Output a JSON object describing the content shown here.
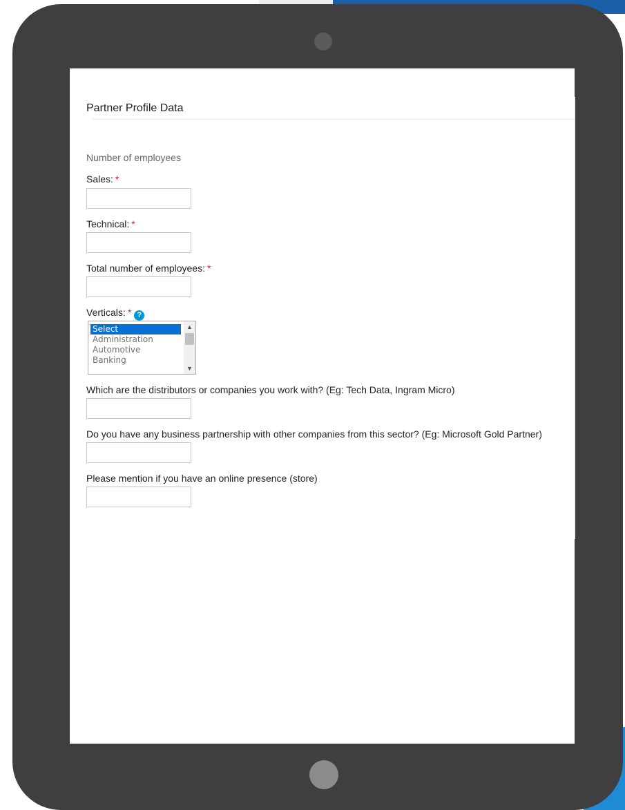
{
  "form": {
    "title": "Partner Profile Data",
    "employees_heading": "Number of employees",
    "required_mark": "*",
    "fields": {
      "sales": {
        "label": "Sales:",
        "value": ""
      },
      "technical": {
        "label": "Technical:",
        "value": ""
      },
      "total_employees": {
        "label": "Total number of employees:",
        "value": ""
      },
      "distributors": {
        "label": "Which are the distributors or companies you work with? (Eg: Tech Data, Ingram Micro)",
        "value": ""
      },
      "partnerships": {
        "label": "Do you have any business partnership with other companies from this sector? (Eg: Microsoft Gold Partner)",
        "value": ""
      },
      "online_presence": {
        "label": "Please mention if you have an online presence (store)",
        "value": ""
      }
    },
    "verticals": {
      "label": "Verticals:",
      "help_glyph": "?",
      "options": [
        "Select",
        "Administration",
        "Automotive",
        "Banking"
      ],
      "selected": "Select",
      "scroll_up_glyph": "▲",
      "scroll_down_glyph": "▼"
    }
  },
  "colors": {
    "tablet_frame": "#3f3f41",
    "required": "#e31b23",
    "help_icon": "#0096d6",
    "selected_option": "#0a70d6",
    "top_strip_blue": "#1a5fa8"
  }
}
